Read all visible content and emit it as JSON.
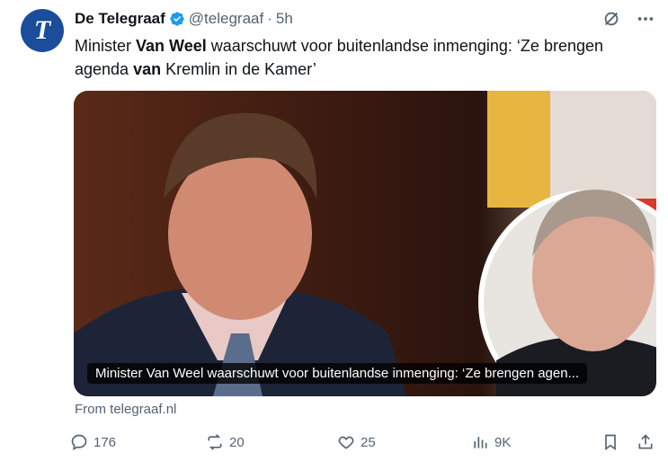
{
  "author": {
    "name": "De Telegraaf",
    "handle": "@telegraaf",
    "separator": "·",
    "time": "5h",
    "avatar_letter": "T"
  },
  "tweet": {
    "parts": [
      {
        "text": "Minister ",
        "bold": false
      },
      {
        "text": "Van Weel",
        "bold": true
      },
      {
        "text": " waarschuwt voor buitenlandse inmenging: ‘Ze brengen agenda ",
        "bold": false
      },
      {
        "text": "van",
        "bold": true
      },
      {
        "text": " Kremlin in de Kamer’",
        "bold": false
      }
    ]
  },
  "media": {
    "caption": "Minister Van Weel waarschuwt voor buitenlandse inmenging: ‘Ze brengen agen..."
  },
  "source": "From telegraaf.nl",
  "actions": {
    "replies": "176",
    "reposts": "20",
    "likes": "25",
    "views": "9K"
  },
  "colors": {
    "avatar": "#1a4d9a",
    "verified": "#1d9bf0",
    "muted": "#536471"
  },
  "icons": [
    "grok-icon",
    "more-icon",
    "reply-icon",
    "repost-icon",
    "like-icon",
    "views-icon",
    "bookmark-icon",
    "share-icon",
    "verified-badge-icon"
  ]
}
